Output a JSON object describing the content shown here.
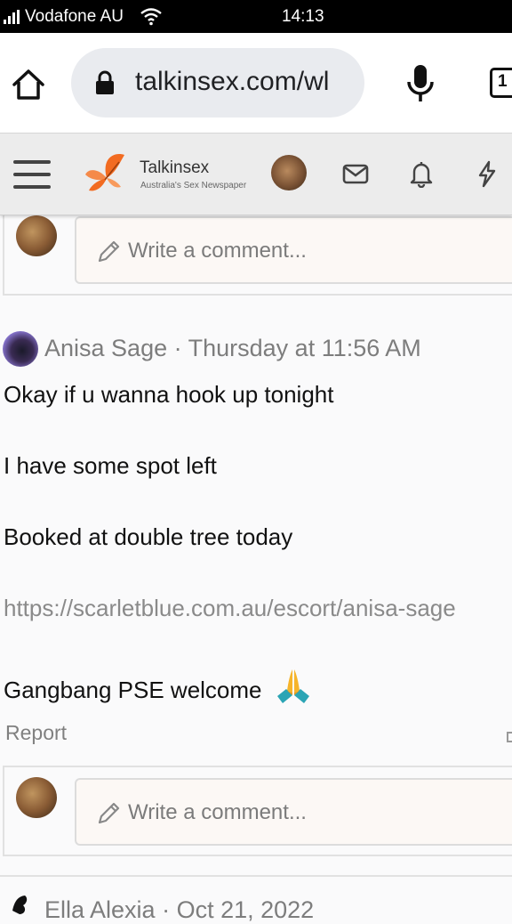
{
  "status_bar": {
    "carrier": "Vodafone AU",
    "time": "14:13"
  },
  "browser": {
    "url": "talkinsex.com/wl",
    "tab_count": "1"
  },
  "site_header": {
    "logo_name": "Talkinsex",
    "logo_tagline": "Australia's Sex Newspaper"
  },
  "comment_placeholder": "Write a comment...",
  "post": {
    "author": "Anisa Sage",
    "separator": " · ",
    "timestamp": "Thursday at 11:56 AM",
    "lines": [
      "Okay if u wanna hook up tonight",
      "I have some spot left",
      "Booked at double tree today"
    ],
    "link": "https://scarletblue.com.au/escort/anisa-sage",
    "last_line": "Gangbang PSE welcome",
    "report_label": "Report"
  },
  "next_post": {
    "author": "Ella Alexia",
    "separator": " · ",
    "timestamp": "Oct 21, 2022"
  },
  "colors": {
    "accent": "#f26b21",
    "meta_gray": "#7d7d7d"
  }
}
